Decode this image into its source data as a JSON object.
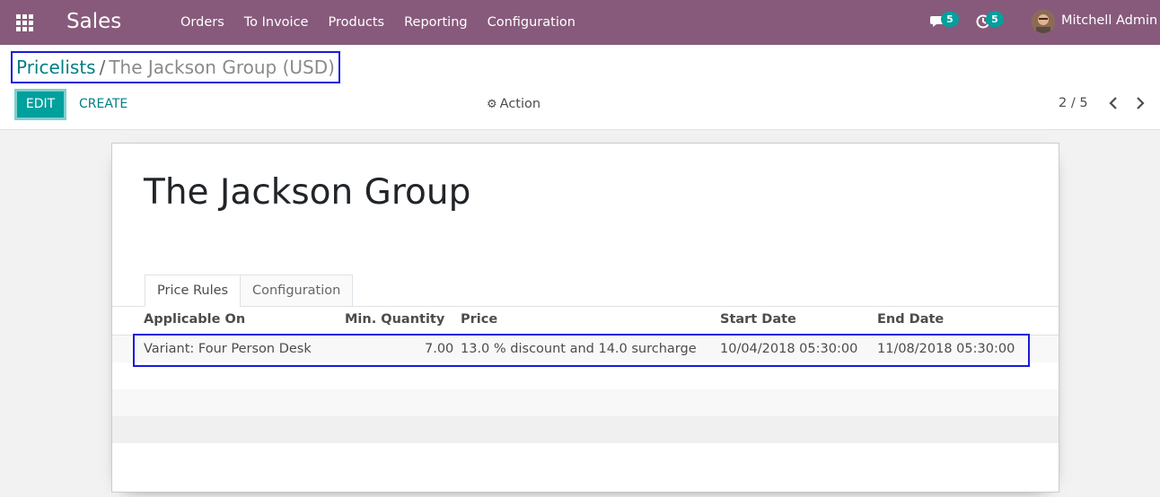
{
  "navbar": {
    "app_name": "Sales",
    "menu": [
      "Orders",
      "To Invoice",
      "Products",
      "Reporting",
      "Configuration"
    ],
    "messages_count": "5",
    "activities_count": "5",
    "user_name": "Mitchell Admin"
  },
  "breadcrumb": {
    "parent": "Pricelists",
    "separator": "/",
    "current": "The Jackson Group (USD)"
  },
  "buttons": {
    "edit": "EDIT",
    "create": "CREATE",
    "action": "Action"
  },
  "pager": {
    "value": "2 / 5"
  },
  "record": {
    "name": "The Jackson Group"
  },
  "tabs": [
    "Price Rules",
    "Configuration"
  ],
  "table": {
    "headers": [
      "Applicable On",
      "Min. Quantity",
      "Price",
      "Start Date",
      "End Date"
    ],
    "rows": [
      {
        "applicable_on": "Variant: Four Person Desk",
        "min_quantity": "7.00",
        "price": "13.0 % discount and 14.0 surcharge",
        "start_date": "10/04/2018 05:30:00",
        "end_date": "11/08/2018 05:30:00"
      }
    ]
  },
  "colors": {
    "navbar": "#875a7b",
    "accent": "#00a09d",
    "link": "#017e84",
    "highlight_box": "#1a1adc"
  }
}
